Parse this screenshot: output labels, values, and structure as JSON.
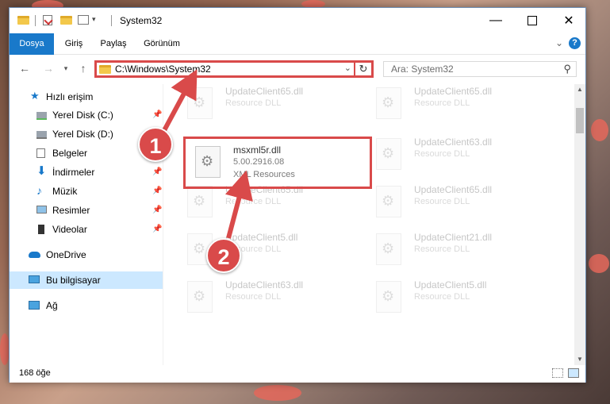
{
  "window": {
    "title": "System32"
  },
  "ribbon": {
    "tabs": [
      "Dosya",
      "Giriş",
      "Paylaş",
      "Görünüm"
    ],
    "help_label": "?"
  },
  "nav": {
    "back_icon": "arrow-left-icon",
    "forward_icon": "arrow-right-icon",
    "up_icon": "arrow-up-icon",
    "address_path": "C:\\Windows\\System32",
    "search_placeholder": "Ara: System32"
  },
  "sidebar": {
    "items": [
      {
        "label": "Hızlı erişim",
        "icon": "star-icon",
        "pinned": false
      },
      {
        "label": "Yerel Disk (C:)",
        "icon": "drive-icon",
        "pinned": true
      },
      {
        "label": "Yerel Disk (D:)",
        "icon": "drive-icon",
        "pinned": false
      },
      {
        "label": "Belgeler",
        "icon": "documents-icon",
        "pinned": true
      },
      {
        "label": "İndirmeler",
        "icon": "download-icon",
        "pinned": true
      },
      {
        "label": "Müzik",
        "icon": "music-icon",
        "pinned": true
      },
      {
        "label": "Resimler",
        "icon": "pictures-icon",
        "pinned": true
      },
      {
        "label": "Videolar",
        "icon": "video-icon",
        "pinned": true
      },
      {
        "label": "OneDrive",
        "icon": "cloud-icon",
        "pinned": false
      },
      {
        "label": "Bu bilgisayar",
        "icon": "computer-icon",
        "pinned": false,
        "selected": true
      },
      {
        "label": "Ağ",
        "icon": "network-icon",
        "pinned": false
      }
    ]
  },
  "files": {
    "selected": {
      "name": "msxml5r.dll",
      "version": "5.00.2916.08",
      "description": "XML Resources"
    },
    "background_left": [
      {
        "name": "UpdateClient65.dll",
        "type": "Resource DLL"
      },
      {
        "name": "UpdateClient65.dll",
        "type": "Resource DLL"
      },
      {
        "name": "UpdateClient5.dll",
        "type": "Resource DLL"
      },
      {
        "name": "UpdateClient63.dll",
        "type": "Resource DLL"
      }
    ],
    "background_right": [
      {
        "name": "UpdateClient65.dll",
        "type": "Resource DLL"
      },
      {
        "name": "UpdateClient63.dll",
        "type": "Resource DLL"
      },
      {
        "name": "UpdateClient65.dll",
        "type": "Resource DLL"
      },
      {
        "name": "UpdateClient21.dll",
        "type": "Resource DLL"
      },
      {
        "name": "UpdateClient5.dll",
        "type": "Resource DLL"
      }
    ]
  },
  "status": {
    "item_count": "168 öğe"
  },
  "annotations": {
    "step1": "1",
    "step2": "2",
    "accent_color": "#d94a4a"
  }
}
